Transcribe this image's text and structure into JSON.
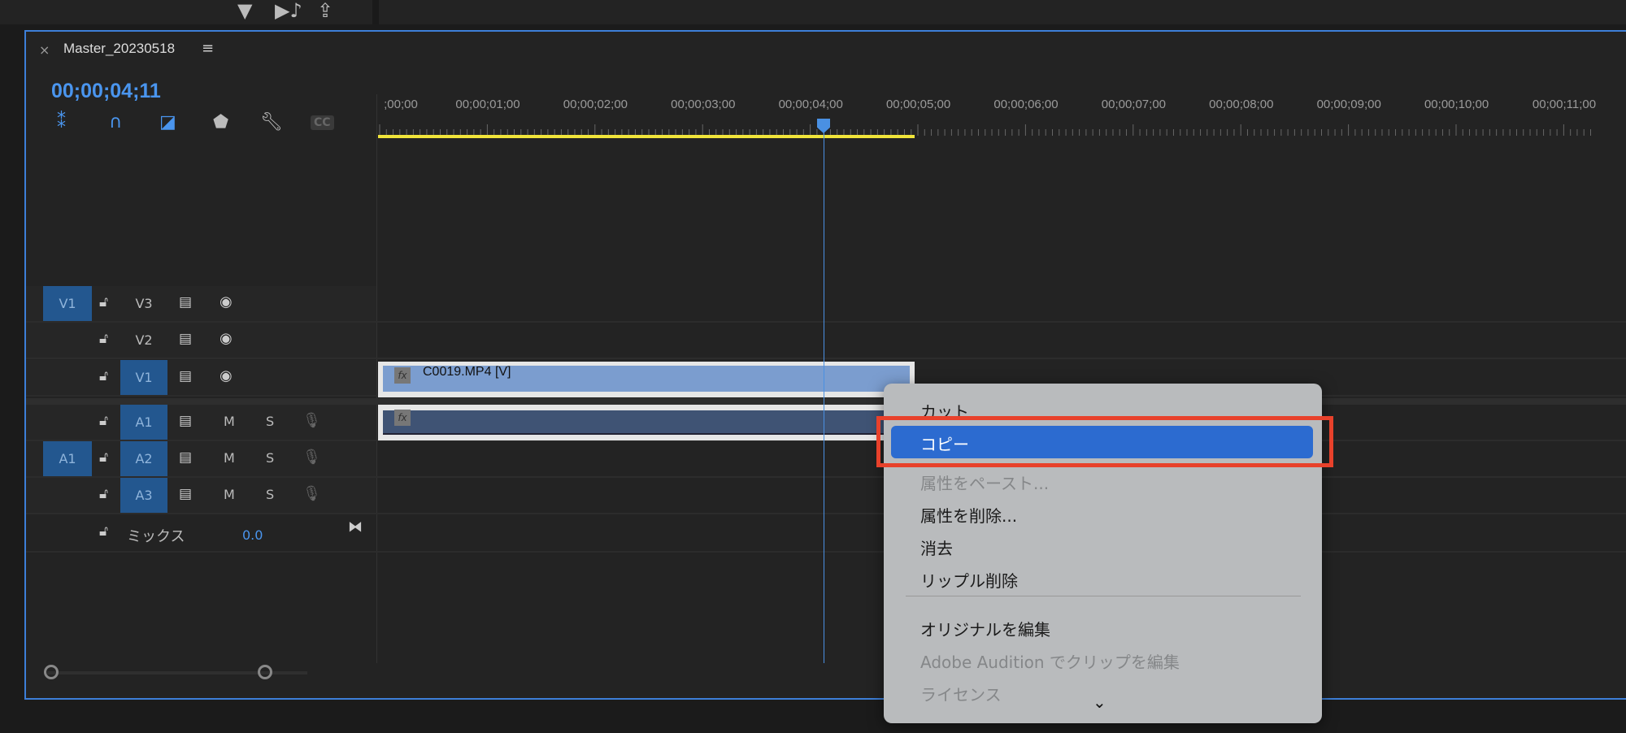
{
  "topbar": {
    "icons": [
      "filter-icon",
      "audio-play-icon",
      "export-icon"
    ]
  },
  "panel": {
    "title": "Master_20230518",
    "close": "×",
    "menu": "≡"
  },
  "timecode": "00;00;04;11",
  "tools": [
    "snap-icon",
    "magnet-icon",
    "linked-selection-icon",
    "marker-icon",
    "wrench-icon",
    "cc-icon"
  ],
  "tools_glyphs": {
    "cc": "CC"
  },
  "ruler": {
    "labels": [
      ";00;00",
      "00;00;01;00",
      "00;00;02;00",
      "00;00;03;00",
      "00;00;04;00",
      "00;00;05;00",
      "00;00;06;00",
      "00;00;07;00",
      "00;00;08;00",
      "00;00;09;00",
      "00;00;10;00",
      "00;00;11;00"
    ]
  },
  "tracks": [
    {
      "label": "V3",
      "patch": "V1",
      "type": "video",
      "targeted": false
    },
    {
      "label": "V2",
      "patch": "",
      "type": "video",
      "targeted": false
    },
    {
      "label": "V1",
      "patch": "",
      "type": "video",
      "targeted": true
    },
    {
      "label": "A1",
      "patch": "",
      "type": "audio",
      "targeted": true
    },
    {
      "label": "A2",
      "patch": "A1",
      "type": "audio",
      "targeted": true
    },
    {
      "label": "A3",
      "patch": "",
      "type": "audio",
      "targeted": true
    }
  ],
  "track_buttons": {
    "mute": "M",
    "solo": "S"
  },
  "mix": {
    "label": "ミックス",
    "value": "0.0"
  },
  "clip": {
    "video_name": "C0019.MP4 [V]",
    "fx": "fx"
  },
  "context_menu": {
    "items": [
      {
        "label": "カット",
        "enabled": true
      },
      {
        "label": "コピー",
        "enabled": true,
        "highlighted": true
      },
      {
        "label": "属性をペースト...",
        "enabled": false
      },
      {
        "label": "属性を削除...",
        "enabled": true
      },
      {
        "label": "消去",
        "enabled": true
      },
      {
        "label": "リップル削除",
        "enabled": true
      },
      {
        "label": "オリジナルを編集",
        "enabled": true
      },
      {
        "label": "Adobe Audition でクリップを編集",
        "enabled": false
      },
      {
        "label": "ライセンス",
        "enabled": false
      }
    ]
  },
  "colors": {
    "accent": "#4a95ee",
    "highlight": "#2c6bd0",
    "annotation": "#e8412b",
    "work_area": "#f0e43a"
  }
}
